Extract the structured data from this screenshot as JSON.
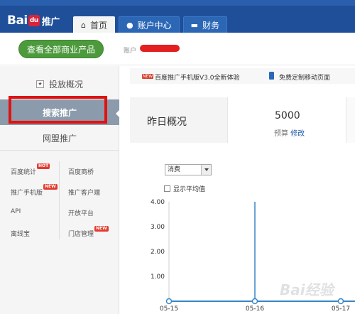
{
  "header": {
    "logo": {
      "text_left": "Bai",
      "text_paw": "du",
      "text_right": "推广"
    },
    "tabs": [
      {
        "label": "首页",
        "icon": "home-icon",
        "active": true
      },
      {
        "label": "账户中心",
        "icon": "user-icon",
        "active": false
      },
      {
        "label": "财务",
        "icon": "card-icon",
        "active": false
      }
    ]
  },
  "subbar": {
    "products_button": "查看全部商业产品",
    "account_label": "账户"
  },
  "sidebar": {
    "items": [
      {
        "label": "投放概况",
        "icon": "star-icon"
      },
      {
        "label": "搜索推广",
        "active": true
      },
      {
        "label": "网盟推广"
      }
    ],
    "tools": [
      {
        "label": "百度统计",
        "badge": "HOT"
      },
      {
        "label": "百度商桥"
      },
      {
        "label": "推广手机版",
        "badge": "NEW"
      },
      {
        "label": "推广客户端"
      },
      {
        "label": "API"
      },
      {
        "label": "开放平台"
      },
      {
        "label": "离线宝"
      },
      {
        "label": "门店管理",
        "badge": "NEW"
      }
    ]
  },
  "promo": {
    "tag": "NEW",
    "text1": "百度推广手机版V3.0全新体验",
    "text2": "免费定制移动页面"
  },
  "overview": {
    "title": "昨日概况",
    "value": "5000",
    "label": "预算",
    "link": "修改"
  },
  "controls": {
    "metric_select": "消费",
    "show_average": "显示平均值"
  },
  "chart_data": {
    "type": "line",
    "x": [
      "05-15",
      "05-16",
      "05-17"
    ],
    "series": [
      {
        "values": [
          0,
          0,
          0
        ]
      }
    ],
    "yticks": [
      "4.00",
      "3.00",
      "2.00",
      "1.00"
    ],
    "ylim": [
      0,
      4
    ],
    "color": "#3a86c8",
    "markers": true,
    "grid": false
  },
  "watermark": "Bai经验"
}
